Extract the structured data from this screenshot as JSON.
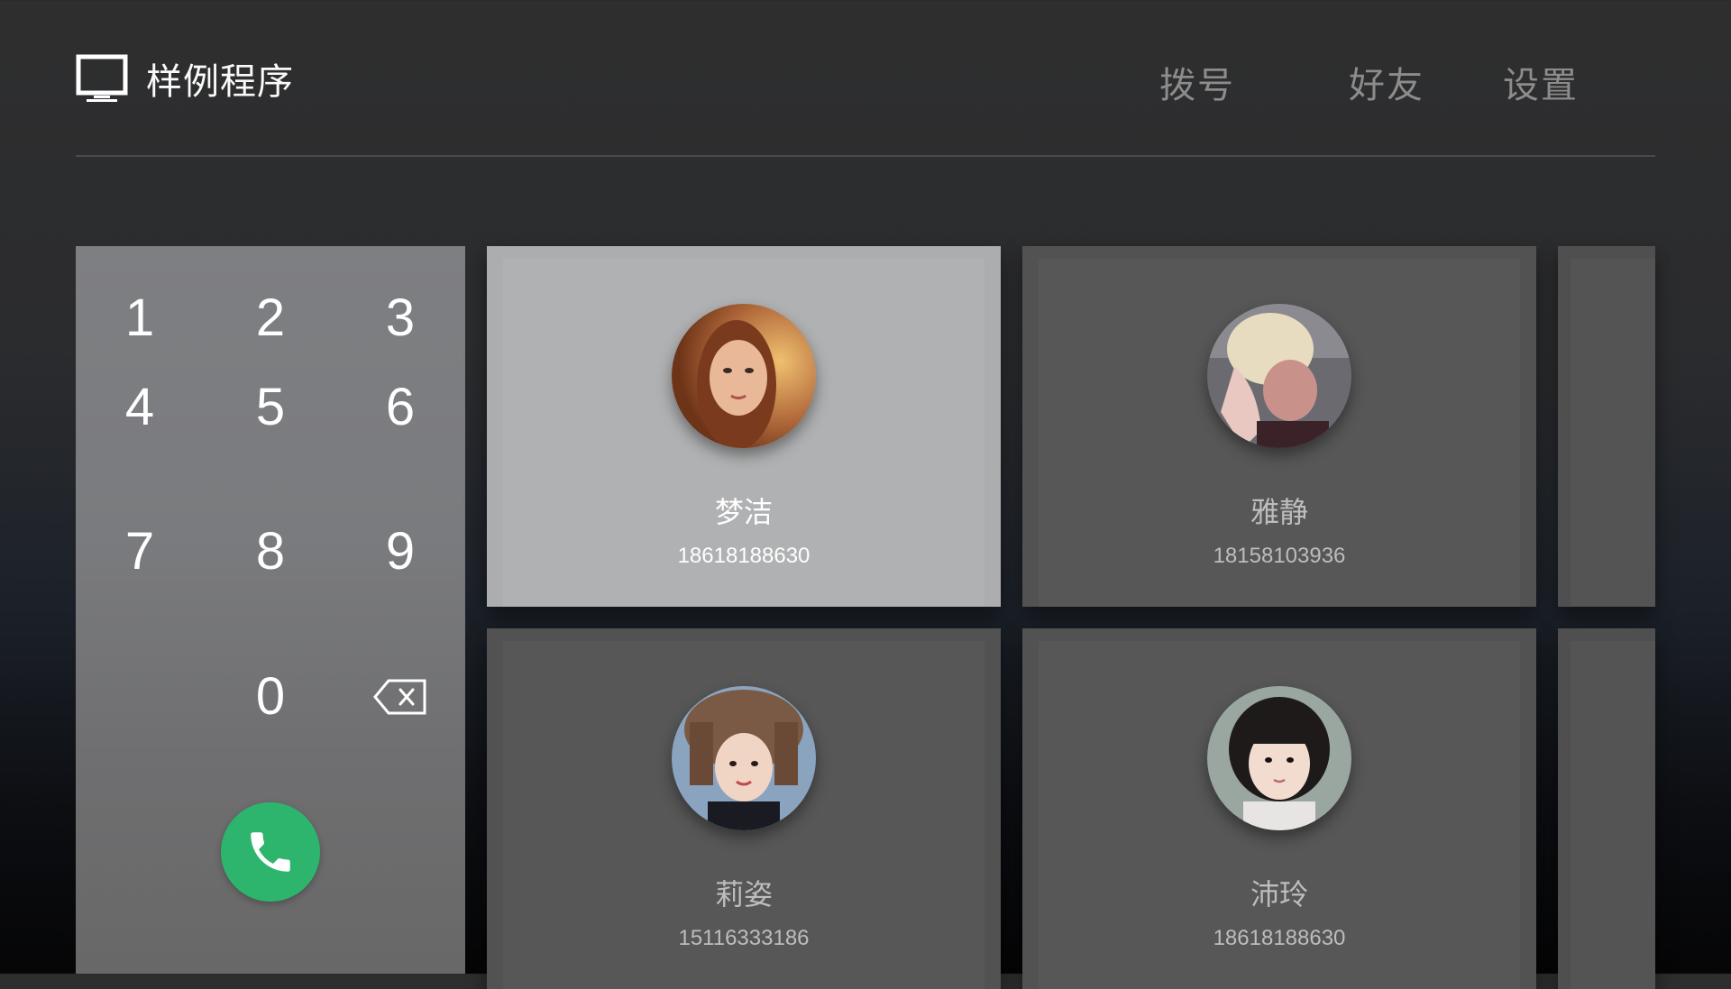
{
  "header": {
    "app_icon": "tv-monitor-icon",
    "app_title": "样例程序",
    "nav": [
      {
        "label": "拨号"
      },
      {
        "label": "好友"
      },
      {
        "label": "设置"
      }
    ]
  },
  "dialpad": {
    "keys": [
      "1",
      "2",
      "3",
      "4",
      "5",
      "6",
      "7",
      "8",
      "9",
      "0"
    ],
    "backspace_icon": "backspace-icon",
    "call_icon": "phone-icon",
    "call_color": "#2db56e"
  },
  "contacts": [
    {
      "name": "梦洁",
      "phone": "18618188630",
      "focused": true
    },
    {
      "name": "雅静",
      "phone": "18158103936",
      "focused": false
    },
    {
      "name": "莉姿",
      "phone": "15116333186",
      "focused": false
    },
    {
      "name": "沛玲",
      "phone": "18618188630",
      "focused": false
    }
  ],
  "colors": {
    "accent_green": "#2db56e",
    "nav_text": "#8c8c8c",
    "focused_card": "#acadae",
    "card": "#525252"
  }
}
